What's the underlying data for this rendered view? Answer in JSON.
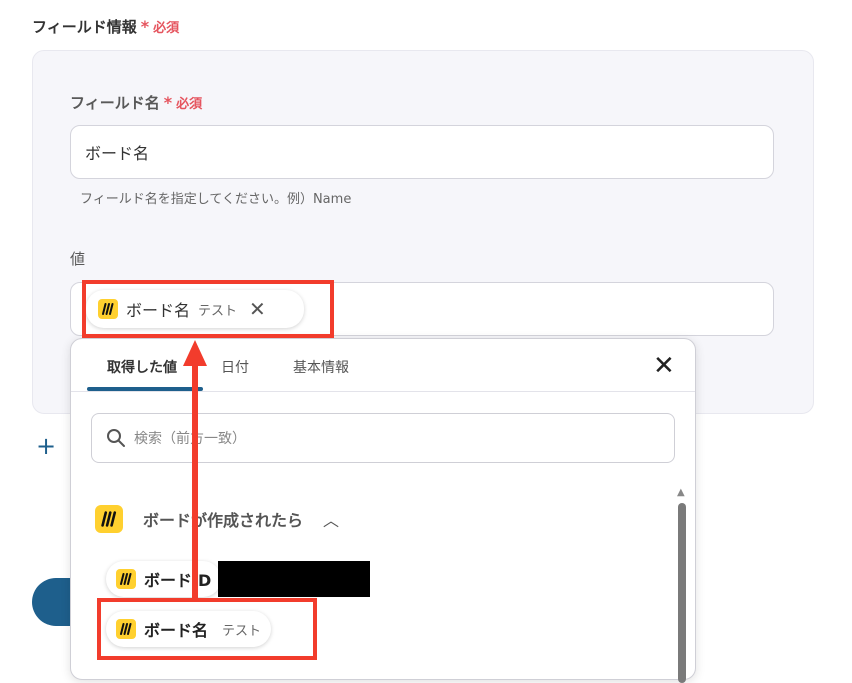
{
  "section": {
    "title": "フィールド情報",
    "required_mark": "*",
    "required_text": "必須"
  },
  "field_name": {
    "label": "フィールド名",
    "required_mark": "*",
    "required_text": "必須",
    "value": "ボード名",
    "hint": "フィールド名を指定してください。例）Name"
  },
  "value_field": {
    "label": "値",
    "chip": {
      "name": "ボード名",
      "sub": "テスト",
      "close": "✕"
    }
  },
  "dropdown": {
    "tabs": [
      {
        "label": "取得した値",
        "active": true
      },
      {
        "label": "日付",
        "active": false
      },
      {
        "label": "基本情報",
        "active": false
      }
    ],
    "close": "✕",
    "search_placeholder": "検索（前方一致）",
    "group": {
      "title": "ボードが作成されたら",
      "chevron": "︿"
    },
    "items": [
      {
        "name": "ボードID",
        "sub": ""
      },
      {
        "name": "ボード名",
        "sub": "テスト"
      }
    ]
  },
  "add_icon": "+",
  "colors": {
    "accent": "#1e5f8c",
    "required": "#e5545e",
    "highlight": "#f23c2c",
    "miro": "#ffd02f"
  }
}
